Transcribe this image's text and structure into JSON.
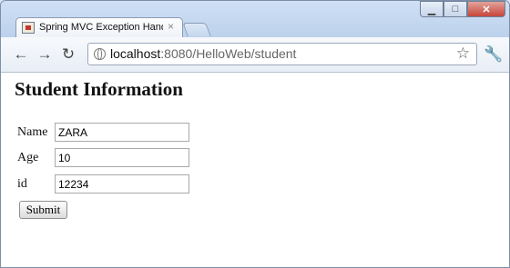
{
  "tab": {
    "title": "Spring MVC Exception Hand",
    "close_glyph": "×"
  },
  "window_controls": {
    "minimize": "▁",
    "maximize": "□",
    "close": "✕"
  },
  "toolbar": {
    "back": "←",
    "forward": "→",
    "reload": "↻",
    "star": "☆",
    "wrench": "🔧",
    "url_host": "localhost",
    "url_rest": ":8080/HelloWeb/student"
  },
  "page": {
    "heading": "Student Information",
    "fields": [
      {
        "label": "Name",
        "value": "ZARA"
      },
      {
        "label": "Age",
        "value": "10"
      },
      {
        "label": "id",
        "value": "12234"
      }
    ],
    "submit_label": "Submit"
  },
  "icons": {
    "tab_favicon": "page-favicon-icon",
    "omnibox": "globe-icon"
  }
}
